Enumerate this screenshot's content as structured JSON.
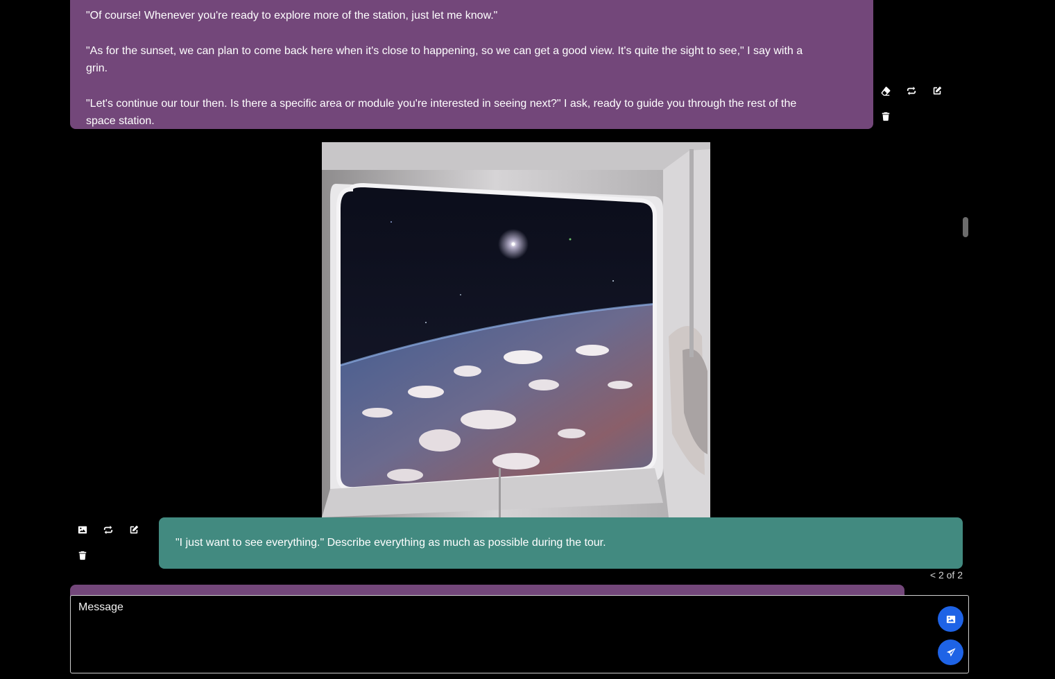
{
  "assistant_message": {
    "paragraphs": [
      "\"Of course! Whenever you're ready to explore more of the station, just let me know.\"",
      "\"As for the sunset, we can plan to come back here when it's close to happening, so we can get a good view. It's quite the sight to see,\" I say with a grin.",
      "\"Let's continue our tour then. Is there a specific area or module you're interested in seeing next?\" I ask, ready to guide you through the rest of the space station."
    ],
    "actions": [
      "eraser-icon",
      "regenerate-icon",
      "edit-icon",
      "trash-icon"
    ]
  },
  "generated_image": {
    "subject": "space-station-window-earth-view"
  },
  "user_message": {
    "text": "\"I just want to see everything.\" Describe everything as much as possible during the tour.",
    "actions": [
      "image-icon",
      "regenerate-icon",
      "edit-icon",
      "trash-icon"
    ],
    "pager": "< 2 of 2"
  },
  "composer": {
    "placeholder": "Message",
    "value": "",
    "buttons": [
      "image-icon",
      "send-icon"
    ]
  },
  "colors": {
    "assistant_bubble": "#73477a",
    "user_bubble": "#428a80",
    "accent_button": "#1e63e6",
    "background": "#000000"
  }
}
